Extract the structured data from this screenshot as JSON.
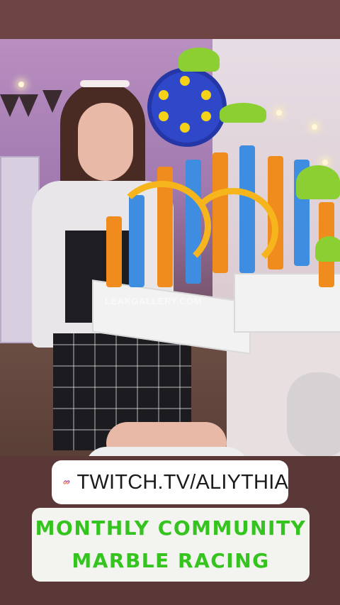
{
  "photo": {
    "watermark": "LEAKGALLERY.COM"
  },
  "twitch_sticker": {
    "icon": "link-icon",
    "text": "TWITCH.TV/ALIYTHIA"
  },
  "caption": {
    "line1": "MONTHLY COMMUNITY",
    "line2": "MARBLE RACING",
    "color": "#35c41f"
  }
}
